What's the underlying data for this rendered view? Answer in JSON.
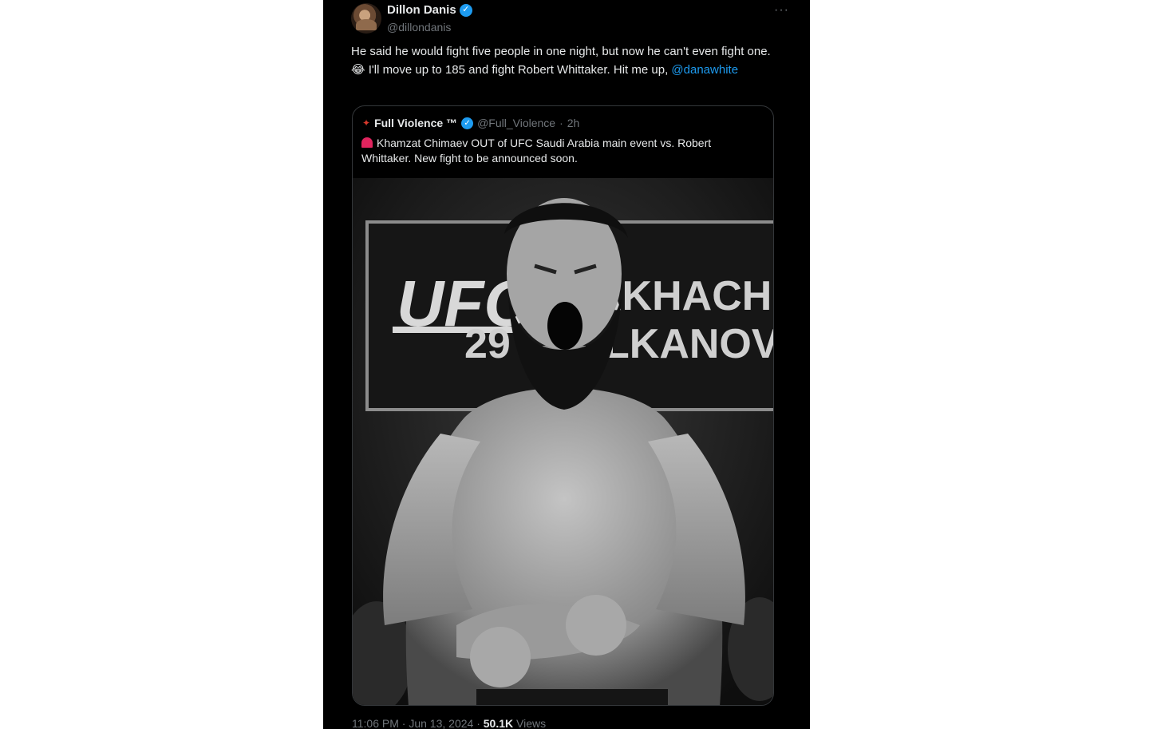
{
  "author": {
    "display_name": "Dillon Danis",
    "handle": "@dillondanis",
    "verified_icon": "verified-badge-icon",
    "more_label": "···"
  },
  "tweet": {
    "text_before": "He said he would fight five people in one night, but now he can't even fight one. ",
    "emoji": "😂",
    "text_after": " I'll move up to 185 and fight Robert Whittaker. Hit me up, ",
    "mention": "@danawhite"
  },
  "quote": {
    "display_name": "Full Violence ™",
    "handle": "@Full_Violence",
    "separator": "·",
    "time": "2h",
    "text": "Khamzat Chimaev OUT of UFC Saudi Arabia main event vs. Robert Whittaker. New fight to be announced soon."
  },
  "photo_banner": {
    "logo": "UFC",
    "line1": "AKHACH",
    "line2": "29",
    "line3": "LKANOVS"
  },
  "footer": {
    "time": "11:06 PM",
    "separator": "·",
    "date": "Jun 13, 2024",
    "separator2": "·",
    "views_count": "50.1K",
    "views_label": "Views"
  },
  "colors": {
    "background": "#000000",
    "text": "#e7e9ea",
    "muted": "#71767b",
    "accent": "#1d9bf0"
  }
}
